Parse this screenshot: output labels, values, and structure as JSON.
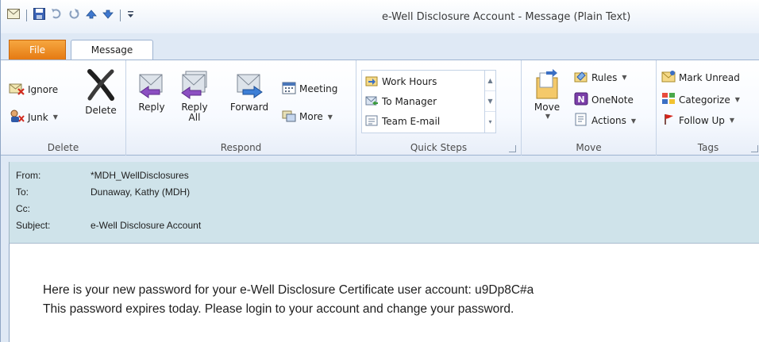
{
  "window": {
    "title": "e-Well Disclosure Account  -  Message (Plain Text)"
  },
  "quick_access": {
    "icons": [
      "mail-icon",
      "save-icon",
      "undo-icon",
      "redo-icon",
      "up-arrow-icon",
      "down-arrow-icon",
      "customize-icon"
    ]
  },
  "tabs": [
    {
      "label": "File"
    },
    {
      "label": "Message"
    }
  ],
  "ribbon": {
    "delete_group": {
      "label": "Delete",
      "ignore": "Ignore",
      "junk": "Junk",
      "delete": "Delete"
    },
    "respond_group": {
      "label": "Respond",
      "reply": "Reply",
      "reply_all_line1": "Reply",
      "reply_all_line2": "All",
      "forward": "Forward",
      "meeting": "Meeting",
      "more": "More"
    },
    "quick_steps_group": {
      "label": "Quick Steps",
      "items": [
        "Work Hours",
        "To Manager",
        "Team E-mail"
      ]
    },
    "move_group": {
      "label": "Move",
      "move": "Move",
      "rules": "Rules",
      "onenote": "OneNote",
      "actions": "Actions"
    },
    "tags_group": {
      "label": "Tags",
      "mark_unread": "Mark Unread",
      "categorize": "Categorize",
      "follow_up": "Follow Up"
    }
  },
  "message": {
    "from_label": "From:",
    "from_value": "*MDH_WellDisclosures",
    "to_label": "To:",
    "to_value": "Dunaway, Kathy (MDH)",
    "cc_label": "Cc:",
    "cc_value": "",
    "subject_label": "Subject:",
    "subject_value": "e-Well Disclosure Account",
    "body_line1": "Here is your new password for your e-Well Disclosure Certificate user account: u9Dp8C#a",
    "body_line2": "This password expires today.  Please login to your account and change your password."
  },
  "colors": {
    "file_tab": "#e57a12",
    "header_bg": "#cfe3ea",
    "ribbon_border": "#9db3d1"
  }
}
